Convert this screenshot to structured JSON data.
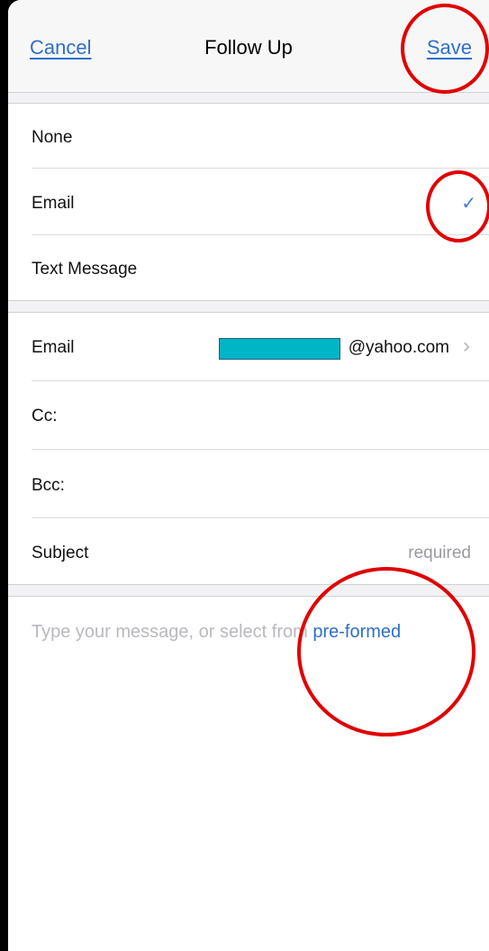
{
  "nav": {
    "cancel_label": "Cancel",
    "title": "Follow Up",
    "save_label": "Save"
  },
  "follow_up_options": [
    {
      "label": "None",
      "selected": false
    },
    {
      "label": "Email",
      "selected": true
    },
    {
      "label": "Text Message",
      "selected": false
    }
  ],
  "check_glyph": "✓",
  "email_fields": {
    "to_label": "Email",
    "to_value": "@yahoo.com",
    "chevron": "›",
    "cc_label": "Cc:",
    "bcc_label": "Bcc:",
    "subject_label": "Subject",
    "subject_placeholder": "required"
  },
  "message": {
    "placeholder": "Type your message, or select from",
    "link": "pre-formed"
  },
  "colors": {
    "accent": "#2f6fc9",
    "annotation": "#e00000",
    "redaction": "#00b5c6"
  }
}
